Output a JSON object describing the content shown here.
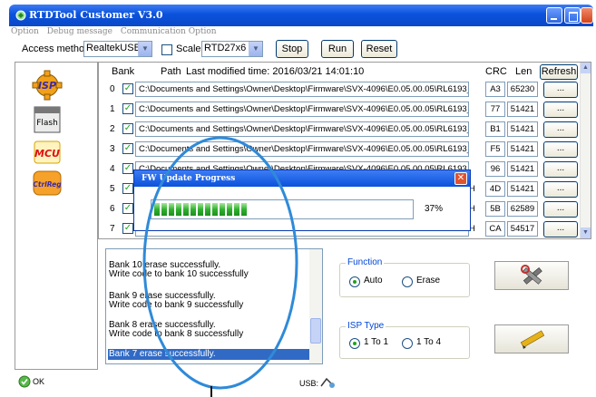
{
  "window": {
    "title": "RTDTool Customer V3.0"
  },
  "menu": [
    "Option",
    "Debug message",
    "Communication Option"
  ],
  "toolbar": {
    "access_label": "Access method:",
    "access_value": "RealtekUSB",
    "scaler_label": "Scaler:",
    "scaler_value": "RTD27x6",
    "stop": "Stop",
    "run": "Run",
    "reset": "Reset"
  },
  "left_icons": [
    {
      "icon": "isp-icon",
      "label": "ISP"
    },
    {
      "icon": "flash-icon",
      "label": "Flash"
    },
    {
      "icon": "mcu-icon",
      "label": "MCU"
    },
    {
      "icon": "ctrlreg-icon",
      "label": "CtrlReg"
    }
  ],
  "banks": {
    "col_bank": "Bank",
    "col_path": "Path",
    "modified": "Last modified time: 2016/03/21 14:01:10",
    "col_crc": "CRC",
    "col_len": "Len",
    "refresh": "Refresh",
    "dots": "...",
    "rows": [
      {
        "num": "0",
        "path": "C:\\Documents and Settings\\Owner\\Desktop\\Firmware\\SVX-4096\\E0.05.00.05\\RL6193_Proje",
        "crc": "A3",
        "len": "65230"
      },
      {
        "num": "1",
        "path": "C:\\Documents and Settings\\Owner\\Desktop\\Firmware\\SVX-4096\\E0.05.00.05\\RL6193_Project.H",
        "crc": "77",
        "len": "51421"
      },
      {
        "num": "2",
        "path": "C:\\Documents and Settings\\Owner\\Desktop\\Firmware\\SVX-4096\\E0.05.00.05\\RL6193_Project.H",
        "crc": "B1",
        "len": "51421"
      },
      {
        "num": "3",
        "path": "C:\\Documents and Settings\\Owner\\Desktop\\Firmware\\SVX-4096\\E0.05.00.05\\RL6193_Project.H",
        "crc": "F5",
        "len": "51421"
      },
      {
        "num": "4",
        "path": "C:\\Documents and Settings\\Owner\\Desktop\\Firmware\\SVX-4096\\E0.05.00.05\\RL6193_Project.H",
        "crc": "96",
        "len": "51421"
      },
      {
        "num": "5",
        "path": "",
        "crc": "4D",
        "len": "51421"
      },
      {
        "num": "6",
        "path": "",
        "crc": "5B",
        "len": "62589"
      },
      {
        "num": "7",
        "path": "",
        "crc": "CA",
        "len": "54517"
      }
    ],
    "partial_suffix": "ct.H"
  },
  "log": [
    "Bank 10 erase successfully.",
    "Write code to bank 10 successfully",
    "Bank 9 erase successfully.",
    "Write code to bank 9 successfully",
    "Bank 8 erase successfully.",
    "Write code to bank 8 successfully",
    "Bank 7 erase successfully."
  ],
  "function": {
    "title": "Function",
    "auto": "Auto",
    "erase": "Erase",
    "selected": "Auto"
  },
  "isp_type": {
    "title": "ISP Type",
    "one_to_one": "1 To 1",
    "one_to_four": "1 To 4",
    "selected": "1 To 1"
  },
  "status": {
    "ok": "OK",
    "usb": "USB:"
  },
  "dialog": {
    "title": "FW Update Progress",
    "percent_label": "37%",
    "progress": 0.37
  },
  "colors": {
    "titlebar": "#0a52dc",
    "progress": "#2fb12f",
    "selection": "#316ac5",
    "group_title": "#0046d5"
  }
}
